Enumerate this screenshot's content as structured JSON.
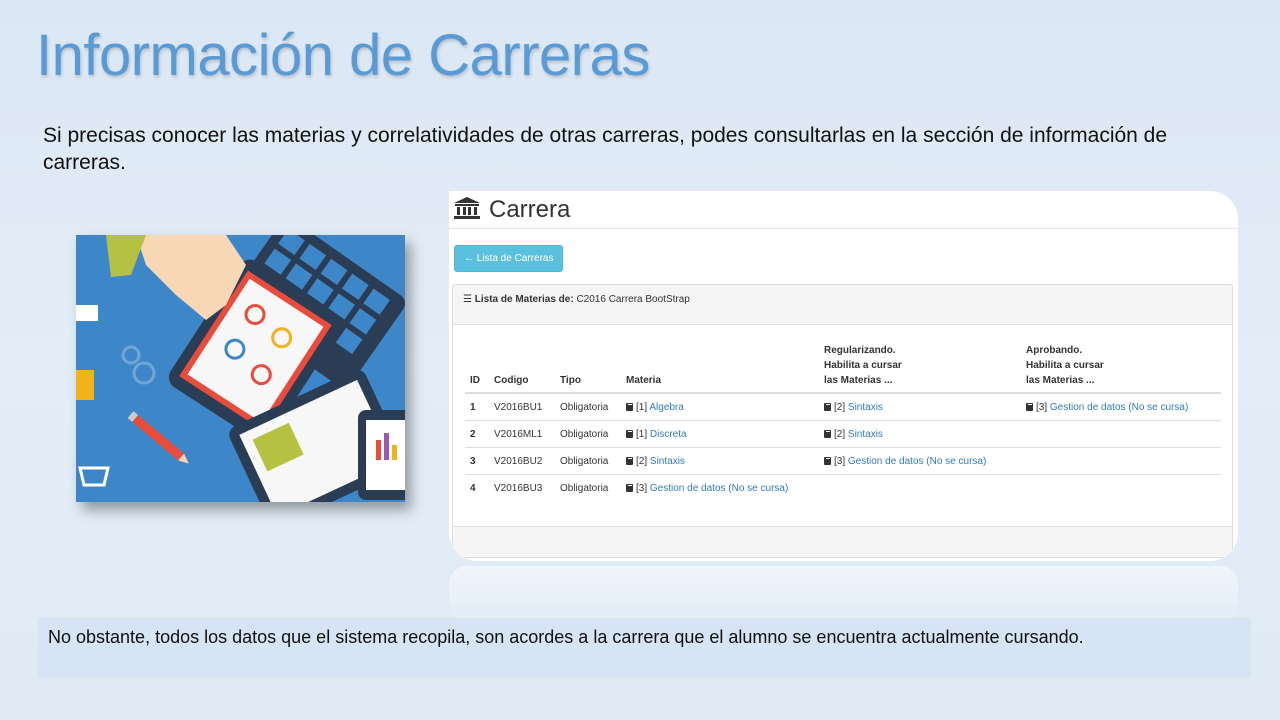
{
  "slide": {
    "title": "Información de Carreras",
    "intro": "Si precisas conocer las materias y correlatividades de otras carreras, podes consultarlas en la sección de información de carreras.",
    "note": "No obstante, todos los datos que el sistema recopila, son acordes a la carrera que el alumno se encuentra actualmente cursando."
  },
  "screenshot": {
    "title_icon": "bank-icon",
    "title": "Carrera",
    "back_button": "← Lista de Carreras",
    "panel_heading_label": "Lista de Materias de:",
    "panel_heading_value": "C2016 Carrera BootStrap",
    "columns": {
      "id": "ID",
      "codigo": "Codigo",
      "tipo": "Tipo",
      "materia": "Materia",
      "regularizando_1": "Regularizando.",
      "regularizando_2": "Habilita a cursar",
      "regularizando_3": "las Materias ...",
      "aprobando_1": "Aprobando.",
      "aprobando_2": "Habilita a cursar",
      "aprobando_3": "las Materias ..."
    },
    "rows": [
      {
        "id": "1",
        "codigo": "V2016BU1",
        "tipo": "Obligatoria",
        "materia_num": "[1]",
        "materia": "Algebra",
        "reg_num": "[2]",
        "reg": "Sintaxis",
        "apr_num": "[3]",
        "apr": "Gestion de datos (No se cursa)"
      },
      {
        "id": "2",
        "codigo": "V2016ML1",
        "tipo": "Obligatoria",
        "materia_num": "[1]",
        "materia": "Discreta",
        "reg_num": "[2]",
        "reg": "Sintaxis",
        "apr_num": "",
        "apr": ""
      },
      {
        "id": "3",
        "codigo": "V2016BU2",
        "tipo": "Obligatoria",
        "materia_num": "[2]",
        "materia": "Sintaxis",
        "reg_num": "[3]",
        "reg": "Gestion de datos (No se cursa)",
        "apr_num": "",
        "apr": ""
      },
      {
        "id": "4",
        "codigo": "V2016BU3",
        "tipo": "Obligatoria",
        "materia_num": "[3]",
        "materia": "Gestion de datos (No se cursa)",
        "reg_num": "",
        "reg": "",
        "apr_num": "",
        "apr": ""
      }
    ]
  },
  "colors": {
    "title": "#5b9bd5",
    "info_button": "#5bc0de",
    "link": "#337ab7"
  }
}
